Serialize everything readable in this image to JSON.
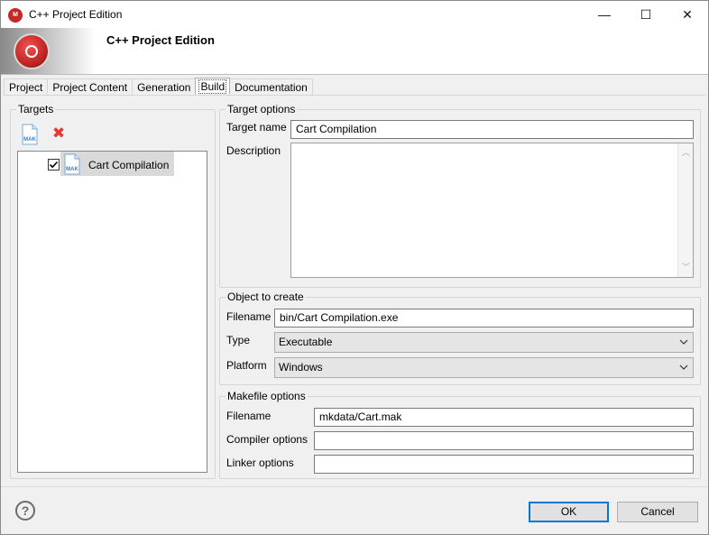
{
  "window": {
    "title": "C++ Project Edition",
    "app_icon_text": "M",
    "minimize_glyph": "—",
    "maximize_glyph": "☐",
    "close_glyph": "✕"
  },
  "banner": {
    "title": "C++ Project Edition"
  },
  "tabs": [
    {
      "label": "Project"
    },
    {
      "label": "Project Content"
    },
    {
      "label": "Generation"
    },
    {
      "label": "Build",
      "active": true
    },
    {
      "label": "Documentation"
    }
  ],
  "targets": {
    "title": "Targets",
    "toolbar": {
      "new_icon": "mak-file-icon",
      "new_icon_text": "MAK",
      "delete_icon": "red-x-icon",
      "delete_glyph": "✖"
    },
    "items": [
      {
        "label": "Cart Compilation",
        "checked": true,
        "icon_text": "MAK"
      }
    ]
  },
  "target_options": {
    "title": "Target options",
    "target_name_label": "Target name",
    "target_name_value": "Cart Compilation",
    "description_label": "Description",
    "description_value": ""
  },
  "object_to_create": {
    "title": "Object to create",
    "filename_label": "Filename",
    "filename_value": "bin/Cart Compilation.exe",
    "type_label": "Type",
    "type_value": "Executable",
    "platform_label": "Platform",
    "platform_value": "Windows"
  },
  "makefile_options": {
    "title": "Makefile options",
    "filename_label": "Filename",
    "filename_value": "mkdata/Cart.mak",
    "compiler_label": "Compiler options",
    "compiler_value": "",
    "linker_label": "Linker options",
    "linker_value": ""
  },
  "footer": {
    "help_glyph": "?",
    "ok_label": "OK",
    "cancel_label": "Cancel"
  },
  "colors": {
    "accent": "#0078d7",
    "delete_red": "#e53935",
    "brand_red": "#c62828"
  }
}
